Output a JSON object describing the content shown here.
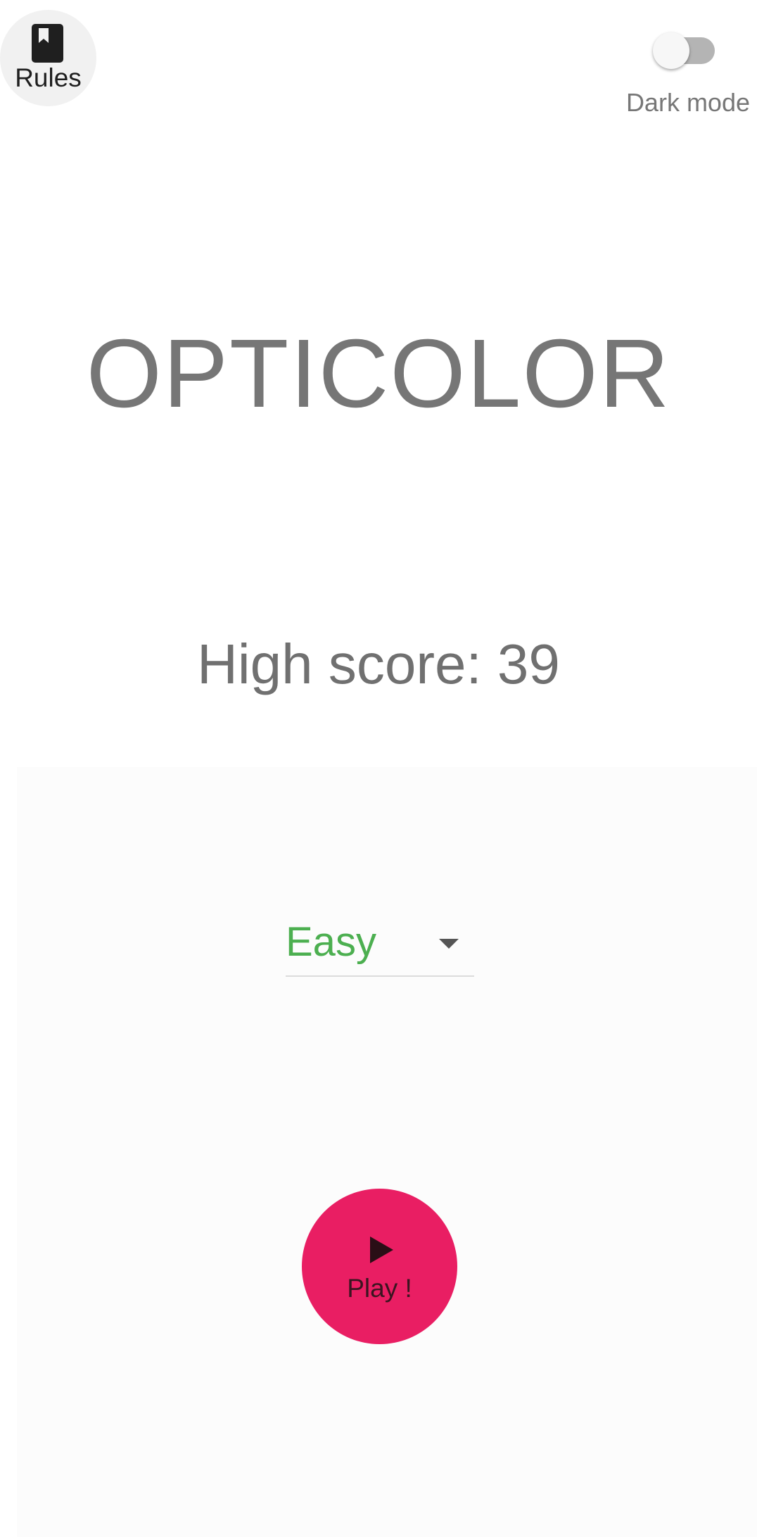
{
  "header": {
    "rules_label": "Rules",
    "dark_mode_label": "Dark mode",
    "dark_mode_on": false
  },
  "main": {
    "title": "OPTICOLOR",
    "high_score_text": "High score: 39",
    "difficulty": {
      "selected": "Easy"
    },
    "play_label": "Play !"
  },
  "colors": {
    "accent": "#e91e63",
    "difficulty_text": "#4caf50",
    "title_text": "#767676"
  },
  "icons": {
    "rules": "book-bookmark-icon",
    "difficulty": "dropdown-arrow-icon",
    "play": "play-icon"
  }
}
